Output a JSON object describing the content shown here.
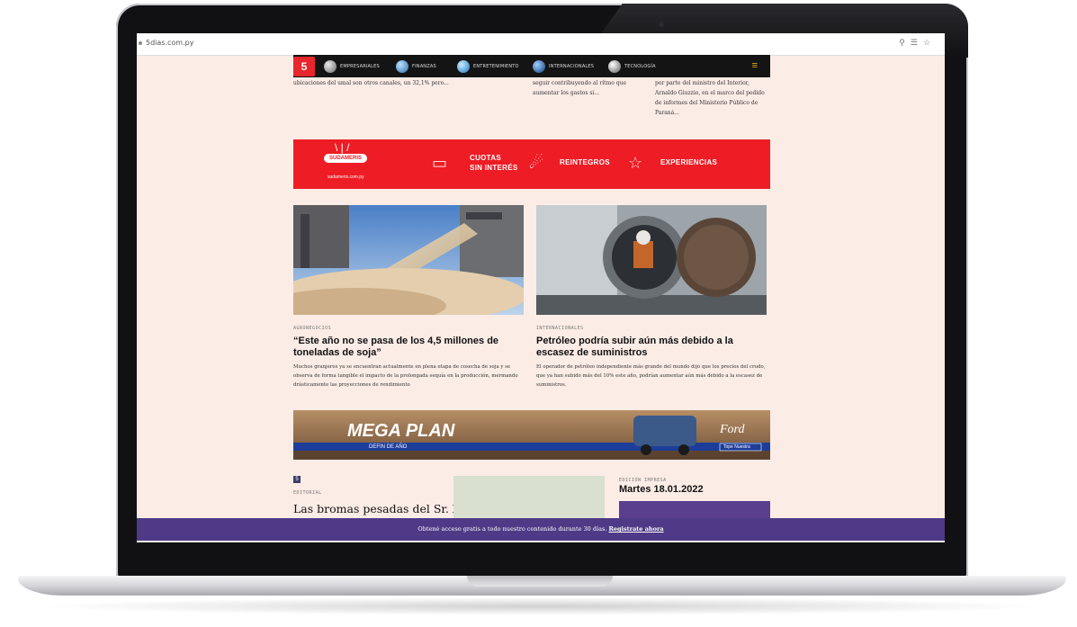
{
  "browser": {
    "url": "5dias.com.py"
  },
  "nav": {
    "logo": "5",
    "items": [
      "EMPRESARIALES",
      "FINANZAS",
      "ENTRETENIMIENTO",
      "INTERNACIONALES",
      "TECNOLOGÍA"
    ]
  },
  "fragments": {
    "left": "ubicaciones del umal son otros canales, un 32,1% pero...",
    "middle_1": "seguir contribuyendo al rítmo que",
    "middle_2": "aumentar los gastos si...",
    "right_1": "por parte del ministro del Interior,",
    "right_2": "Arnaldo Giuzzio, en el marco del pedido",
    "right_3": "de informes del Ministerio Público de",
    "right_4": "Paraná..."
  },
  "banner": {
    "brand": "SUDAMERIS",
    "site": "sudameris.com.py",
    "cuotas_1": "CUOTAS",
    "cuotas_2": "SIN INTERÉS",
    "reintegros": "REINTEGROS",
    "experiencias": "EXPERIENCIAS"
  },
  "articles": [
    {
      "category": "AGRONEGOCIOS",
      "title": "“Este año no se pasa de los 4,5 millones de toneladas de soja”",
      "summary": "Muchos granjeros ya se encuentran actualmente en plena etapa de cosecha de soja y se observa de forma tangible el impacto de la prolongada sequía en la producción, mermando drásticamente las proyecciones de rendimiento"
    },
    {
      "category": "INTERNACIONALES",
      "title": "Petróleo podría subir aún más debido a la escasez de suministros",
      "summary": "El operador de petróleo independiente más grande del mundo dijo que los precios del crudo, que ya han subido más del 10% este año, podrían aumentar aún más debido a la escasez de suministros."
    }
  ],
  "ford_ad": {
    "headline": "MEGA PLAN",
    "sub": "DEFIN DE AÑO",
    "brand": "Ford",
    "tag": "Tope Nuestra"
  },
  "bottom": {
    "category": "EDITORIAL",
    "headline": "Las bromas pesadas del Sr. Xi",
    "edition_label": "EDICIÓN IMPRESA",
    "edition_date": "Martes 18.01.2022"
  },
  "promo": {
    "text": "Obtené acceso gratis a todo nuestro contenido durante 30 días.",
    "link": "Registrate ahora"
  },
  "colors": {
    "brand_red": "#ee1c25",
    "promo_purple": "#4e3a86",
    "page_bg": "#fbece6"
  }
}
